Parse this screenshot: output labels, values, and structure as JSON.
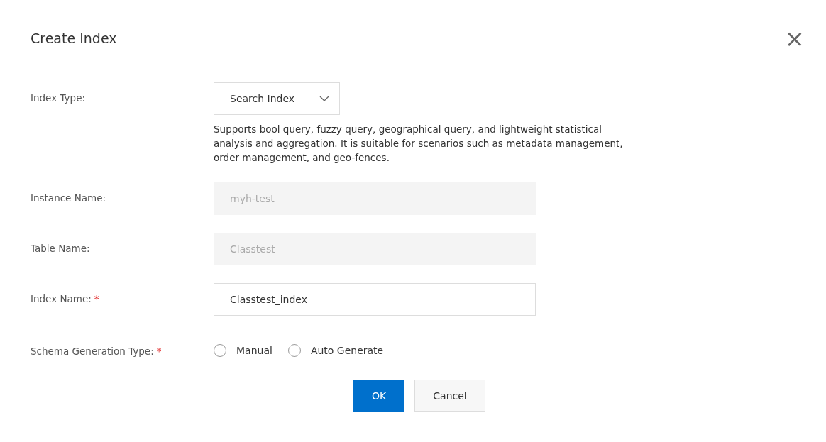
{
  "dialog": {
    "title": "Create Index",
    "close": "×"
  },
  "fields": [
    {
      "kind": "select",
      "label": "Index Type:",
      "value": "Search Index",
      "description": "Supports bool query, fuzzy query, geographical query, and lightweight statistical analysis and aggregation. It is suitable for scenarios such as metadata management, order management, and geo-fences."
    },
    {
      "kind": "input",
      "label": "Instance Name:",
      "value": "myh-test",
      "disabled": true
    },
    {
      "kind": "input",
      "label": "Table Name:",
      "value": "Classtest",
      "disabled": true
    },
    {
      "kind": "input",
      "label": "Index Name:",
      "required_mark": "*",
      "value": "Classtest_index",
      "disabled": false
    },
    {
      "kind": "radio",
      "label": "Schema Generation Type:",
      "required_mark": "*",
      "options": [
        {
          "label": "Manual",
          "selected": false
        },
        {
          "label": "Auto Generate",
          "selected": false
        }
      ]
    }
  ],
  "buttons": [
    {
      "label": "OK",
      "primary": true
    },
    {
      "label": "Cancel",
      "primary": false
    }
  ]
}
